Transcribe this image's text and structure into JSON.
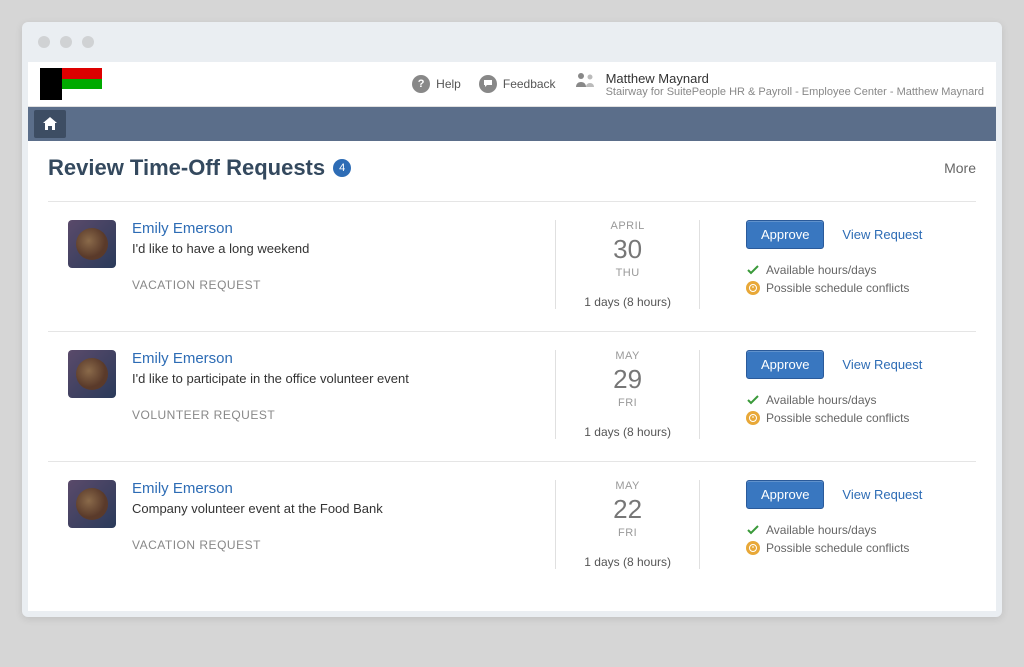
{
  "header": {
    "help": "Help",
    "feedback": "Feedback",
    "user_name": "Matthew Maynard",
    "user_sub": "Stairway for SuitePeople HR & Payroll - Employee Center - Matthew Maynard"
  },
  "page": {
    "title": "Review Time-Off Requests",
    "badge_count": "4",
    "more": "More"
  },
  "labels": {
    "approve": "Approve",
    "view_request": "View Request",
    "available_hours": "Available hours/days",
    "schedule_conflicts": "Possible schedule conflicts"
  },
  "requests": [
    {
      "name": "Emily Emerson",
      "note": "I'd like to have a long weekend",
      "type": "VACATION REQUEST",
      "month": "APRIL",
      "day": "30",
      "dow": "THU",
      "duration": "1 days (8 hours)"
    },
    {
      "name": "Emily Emerson",
      "note": "I'd like to participate in the office volunteer event",
      "type": "VOLUNTEER REQUEST",
      "month": "MAY",
      "day": "29",
      "dow": "FRI",
      "duration": "1 days (8 hours)"
    },
    {
      "name": "Emily Emerson",
      "note": "Company volunteer event at the Food Bank",
      "type": "VACATION REQUEST",
      "month": "MAY",
      "day": "22",
      "dow": "FRI",
      "duration": "1 days (8 hours)"
    }
  ]
}
